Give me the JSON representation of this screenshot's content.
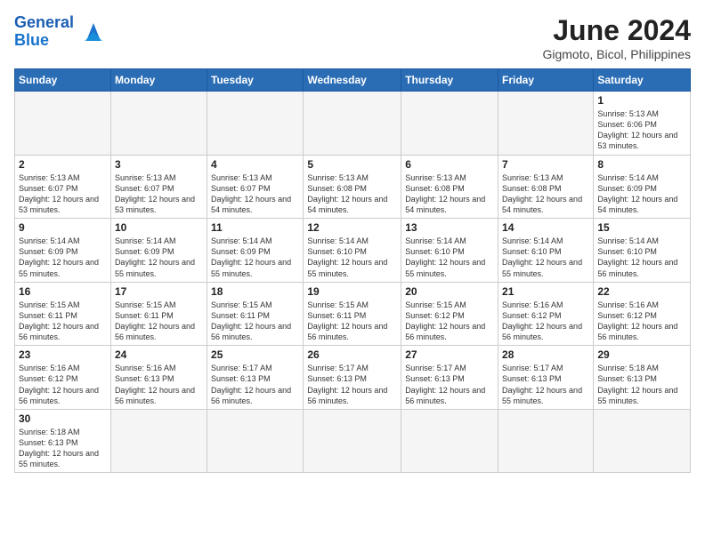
{
  "header": {
    "logo_general": "General",
    "logo_blue": "Blue",
    "title": "June 2024",
    "subtitle": "Gigmoto, Bicol, Philippines"
  },
  "weekdays": [
    "Sunday",
    "Monday",
    "Tuesday",
    "Wednesday",
    "Thursday",
    "Friday",
    "Saturday"
  ],
  "weeks": [
    [
      {
        "day": "",
        "info": "",
        "empty": true
      },
      {
        "day": "",
        "info": "",
        "empty": true
      },
      {
        "day": "",
        "info": "",
        "empty": true
      },
      {
        "day": "",
        "info": "",
        "empty": true
      },
      {
        "day": "",
        "info": "",
        "empty": true
      },
      {
        "day": "",
        "info": "",
        "empty": true
      },
      {
        "day": "1",
        "info": "Sunrise: 5:13 AM\nSunset: 6:06 PM\nDaylight: 12 hours\nand 53 minutes."
      }
    ],
    [
      {
        "day": "2",
        "info": "Sunrise: 5:13 AM\nSunset: 6:07 PM\nDaylight: 12 hours\nand 53 minutes."
      },
      {
        "day": "3",
        "info": "Sunrise: 5:13 AM\nSunset: 6:07 PM\nDaylight: 12 hours\nand 53 minutes."
      },
      {
        "day": "4",
        "info": "Sunrise: 5:13 AM\nSunset: 6:07 PM\nDaylight: 12 hours\nand 54 minutes."
      },
      {
        "day": "5",
        "info": "Sunrise: 5:13 AM\nSunset: 6:08 PM\nDaylight: 12 hours\nand 54 minutes."
      },
      {
        "day": "6",
        "info": "Sunrise: 5:13 AM\nSunset: 6:08 PM\nDaylight: 12 hours\nand 54 minutes."
      },
      {
        "day": "7",
        "info": "Sunrise: 5:13 AM\nSunset: 6:08 PM\nDaylight: 12 hours\nand 54 minutes."
      },
      {
        "day": "8",
        "info": "Sunrise: 5:14 AM\nSunset: 6:09 PM\nDaylight: 12 hours\nand 54 minutes."
      }
    ],
    [
      {
        "day": "9",
        "info": "Sunrise: 5:14 AM\nSunset: 6:09 PM\nDaylight: 12 hours\nand 55 minutes."
      },
      {
        "day": "10",
        "info": "Sunrise: 5:14 AM\nSunset: 6:09 PM\nDaylight: 12 hours\nand 55 minutes."
      },
      {
        "day": "11",
        "info": "Sunrise: 5:14 AM\nSunset: 6:09 PM\nDaylight: 12 hours\nand 55 minutes."
      },
      {
        "day": "12",
        "info": "Sunrise: 5:14 AM\nSunset: 6:10 PM\nDaylight: 12 hours\nand 55 minutes."
      },
      {
        "day": "13",
        "info": "Sunrise: 5:14 AM\nSunset: 6:10 PM\nDaylight: 12 hours\nand 55 minutes."
      },
      {
        "day": "14",
        "info": "Sunrise: 5:14 AM\nSunset: 6:10 PM\nDaylight: 12 hours\nand 55 minutes."
      },
      {
        "day": "15",
        "info": "Sunrise: 5:14 AM\nSunset: 6:10 PM\nDaylight: 12 hours\nand 56 minutes."
      }
    ],
    [
      {
        "day": "16",
        "info": "Sunrise: 5:15 AM\nSunset: 6:11 PM\nDaylight: 12 hours\nand 56 minutes."
      },
      {
        "day": "17",
        "info": "Sunrise: 5:15 AM\nSunset: 6:11 PM\nDaylight: 12 hours\nand 56 minutes."
      },
      {
        "day": "18",
        "info": "Sunrise: 5:15 AM\nSunset: 6:11 PM\nDaylight: 12 hours\nand 56 minutes."
      },
      {
        "day": "19",
        "info": "Sunrise: 5:15 AM\nSunset: 6:11 PM\nDaylight: 12 hours\nand 56 minutes."
      },
      {
        "day": "20",
        "info": "Sunrise: 5:15 AM\nSunset: 6:12 PM\nDaylight: 12 hours\nand 56 minutes."
      },
      {
        "day": "21",
        "info": "Sunrise: 5:16 AM\nSunset: 6:12 PM\nDaylight: 12 hours\nand 56 minutes."
      },
      {
        "day": "22",
        "info": "Sunrise: 5:16 AM\nSunset: 6:12 PM\nDaylight: 12 hours\nand 56 minutes."
      }
    ],
    [
      {
        "day": "23",
        "info": "Sunrise: 5:16 AM\nSunset: 6:12 PM\nDaylight: 12 hours\nand 56 minutes."
      },
      {
        "day": "24",
        "info": "Sunrise: 5:16 AM\nSunset: 6:13 PM\nDaylight: 12 hours\nand 56 minutes."
      },
      {
        "day": "25",
        "info": "Sunrise: 5:17 AM\nSunset: 6:13 PM\nDaylight: 12 hours\nand 56 minutes."
      },
      {
        "day": "26",
        "info": "Sunrise: 5:17 AM\nSunset: 6:13 PM\nDaylight: 12 hours\nand 56 minutes."
      },
      {
        "day": "27",
        "info": "Sunrise: 5:17 AM\nSunset: 6:13 PM\nDaylight: 12 hours\nand 56 minutes."
      },
      {
        "day": "28",
        "info": "Sunrise: 5:17 AM\nSunset: 6:13 PM\nDaylight: 12 hours\nand 55 minutes."
      },
      {
        "day": "29",
        "info": "Sunrise: 5:18 AM\nSunset: 6:13 PM\nDaylight: 12 hours\nand 55 minutes."
      }
    ],
    [
      {
        "day": "30",
        "info": "Sunrise: 5:18 AM\nSunset: 6:13 PM\nDaylight: 12 hours\nand 55 minutes."
      },
      {
        "day": "",
        "info": "",
        "empty": true
      },
      {
        "day": "",
        "info": "",
        "empty": true
      },
      {
        "day": "",
        "info": "",
        "empty": true
      },
      {
        "day": "",
        "info": "",
        "empty": true
      },
      {
        "day": "",
        "info": "",
        "empty": true
      },
      {
        "day": "",
        "info": "",
        "empty": true
      }
    ]
  ]
}
